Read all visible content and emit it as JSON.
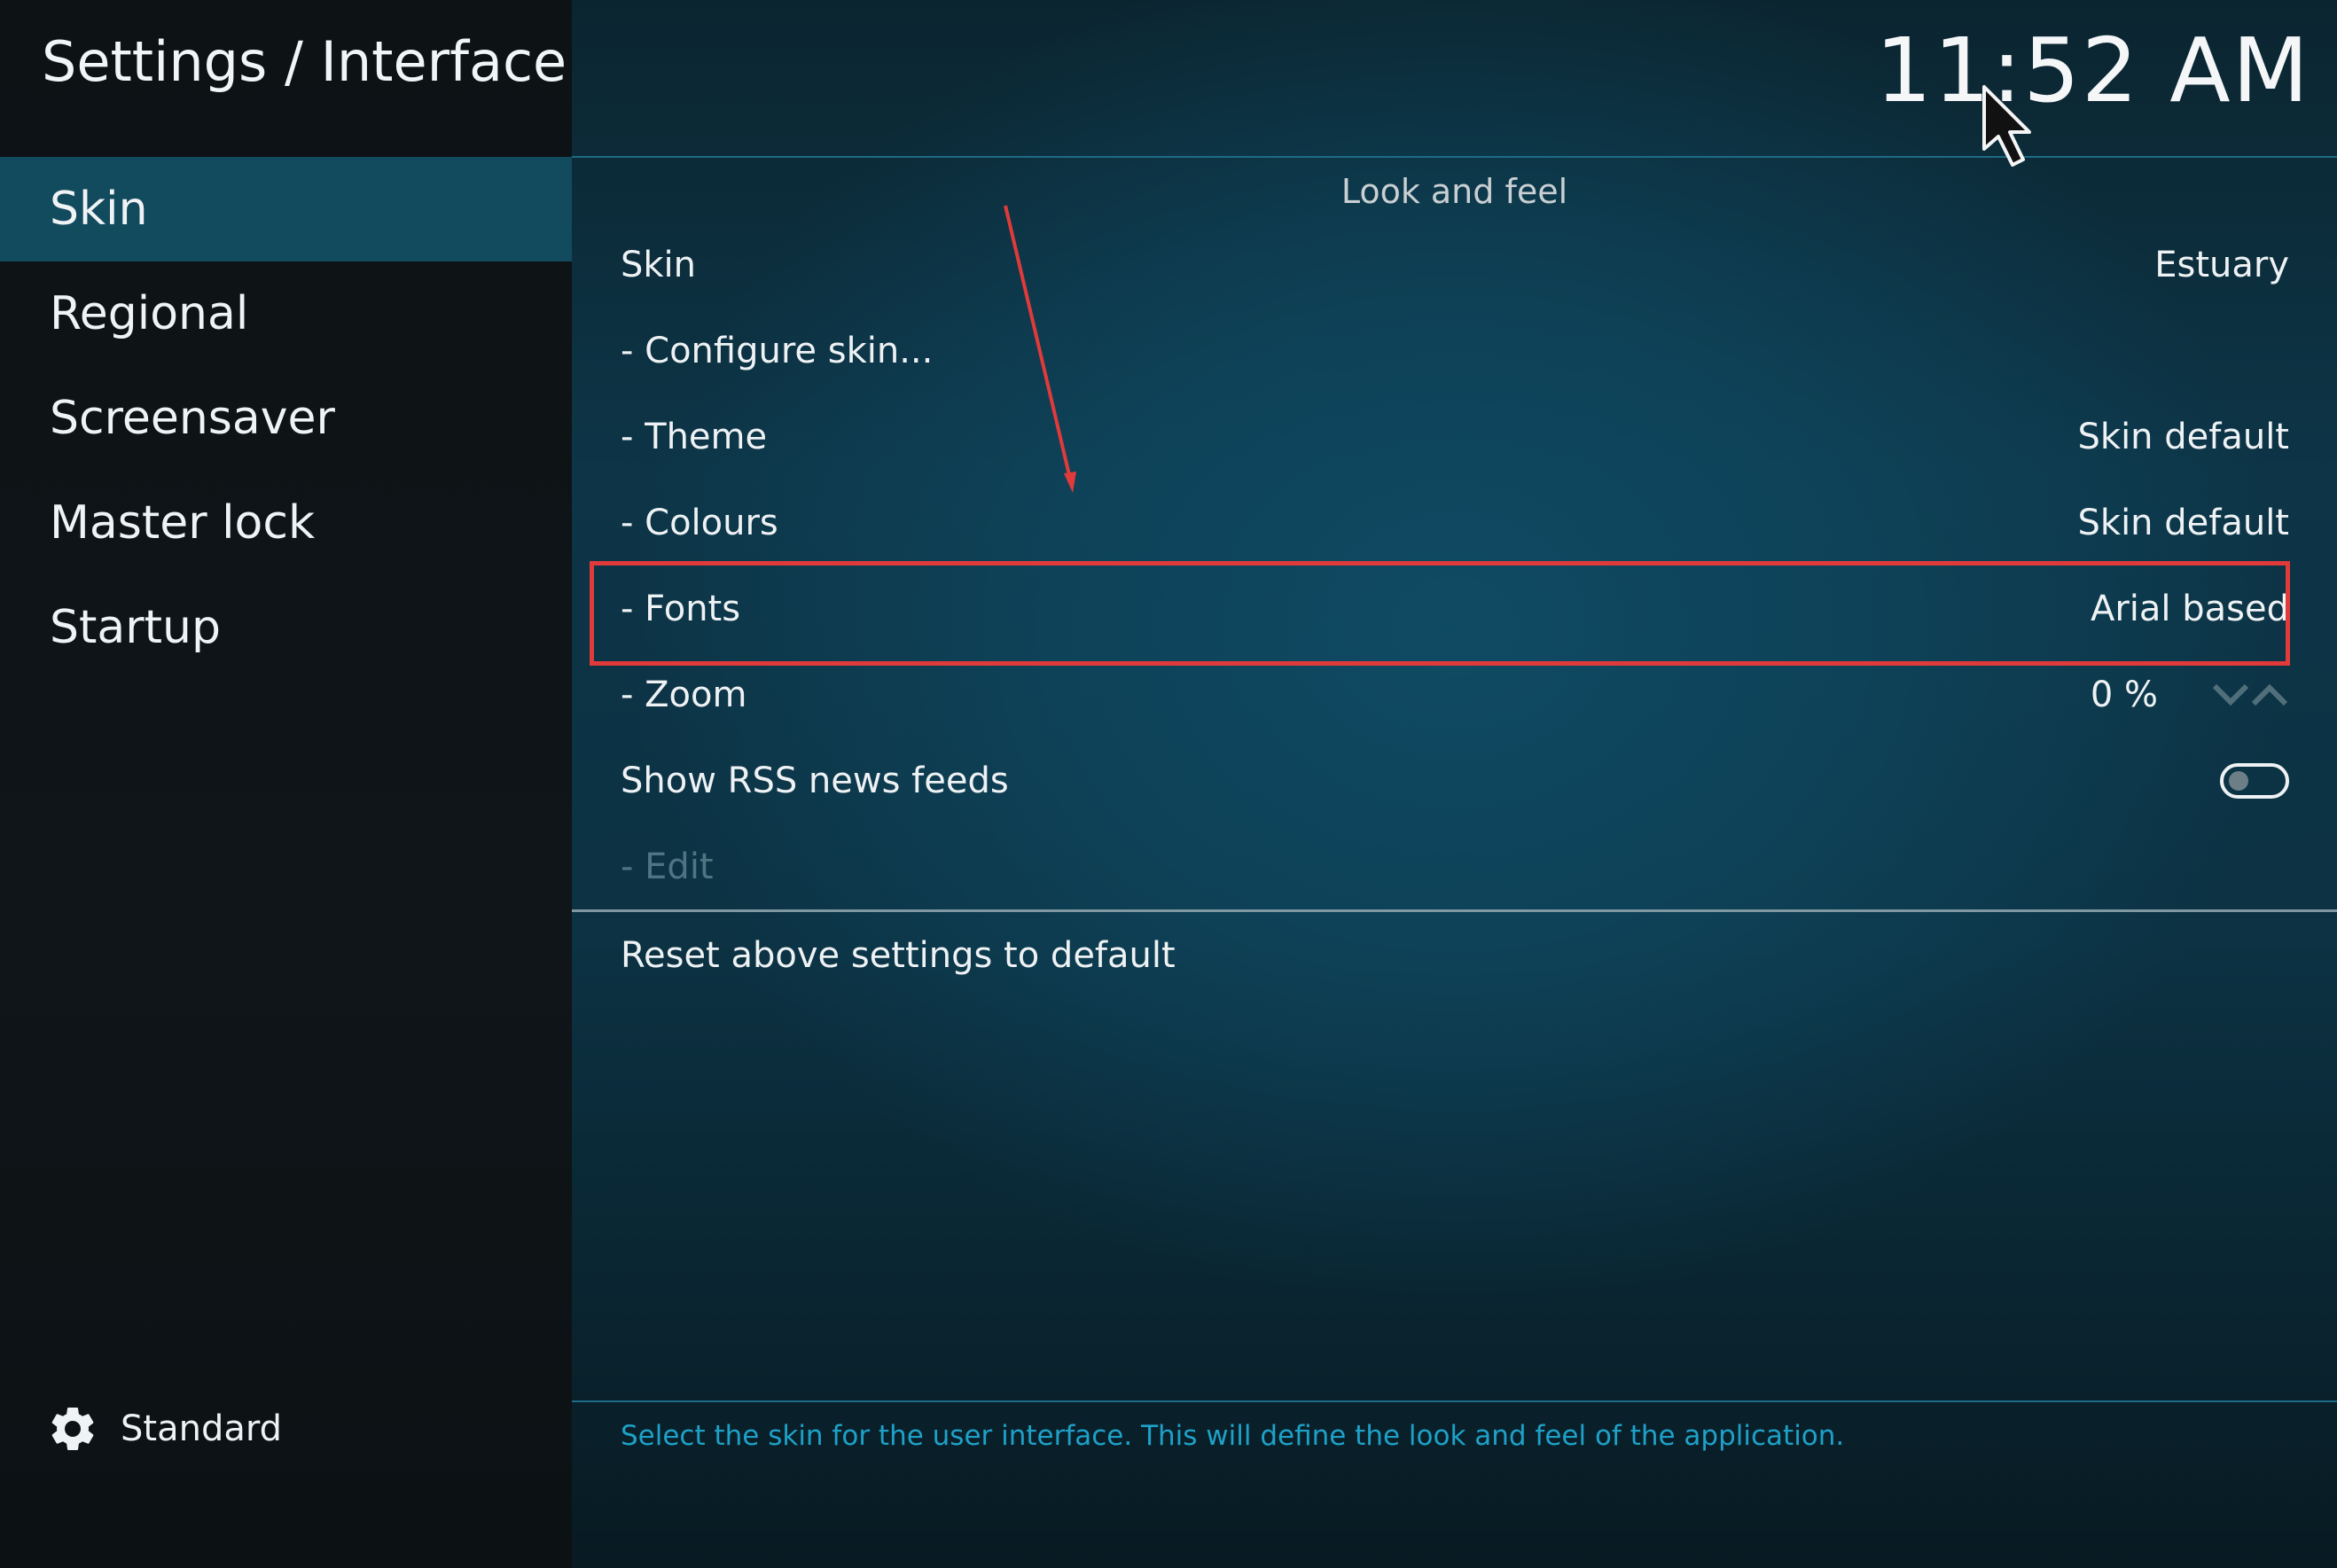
{
  "header": {
    "title": "Settings / Interface",
    "clock": "11:52 AM"
  },
  "sidebar": {
    "items": [
      {
        "label": "Skin",
        "active": true
      },
      {
        "label": "Regional",
        "active": false
      },
      {
        "label": "Screensaver",
        "active": false
      },
      {
        "label": "Master lock",
        "active": false
      },
      {
        "label": "Startup",
        "active": false
      }
    ],
    "settings_level": {
      "icon": "gear-icon",
      "label": "Standard"
    }
  },
  "main": {
    "group_title": "Look and feel",
    "settings": [
      {
        "label": "Skin",
        "value": "Estuary"
      },
      {
        "label": "- Configure skin...",
        "value": ""
      },
      {
        "label": "- Theme",
        "value": "Skin default"
      },
      {
        "label": "- Colours",
        "value": "Skin default"
      },
      {
        "label": "- Fonts",
        "value": "Arial based",
        "highlighted": true
      },
      {
        "label": "- Zoom",
        "value": "0 %",
        "control": "spinner"
      },
      {
        "label": "Show RSS news feeds",
        "value": "",
        "control": "toggle",
        "toggle_on": false
      },
      {
        "label": "- Edit",
        "value": "",
        "disabled": true
      }
    ],
    "reset_label": "Reset above settings to default",
    "help_text": "Select the skin for the user interface. This will define the look and feel of the application."
  },
  "annotations": {
    "highlight_color": "#e03a3a",
    "arrow_color": "#e03a3a"
  },
  "colors": {
    "sidebar_active": "#124a5e",
    "help_text": "#1ea1c8",
    "panel_line": "#1f6a84"
  }
}
